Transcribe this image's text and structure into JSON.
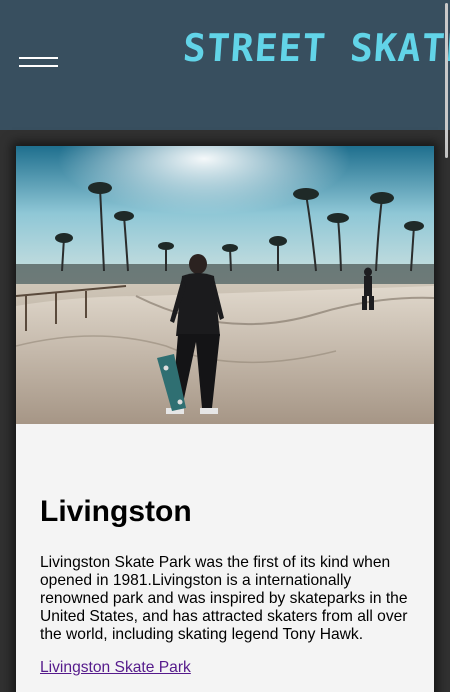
{
  "header": {
    "brand": "STREET SKATER",
    "menu_icon": "hamburger-menu-icon"
  },
  "card": {
    "image_alt": "Skater carrying a skateboard at an outdoor skate park with palm trees",
    "title": "Livingston",
    "description": "Livingston Skate Park was the first of its kind when opened in 1981.Livingston is a internationally renowned park and was inspired by skateparks in the United States, and has attracted skaters from all over the world, including skating legend Tony Hawk.",
    "link_text": "Livingston Skate Park"
  },
  "colors": {
    "page_background": "#313131",
    "header_background": "#384f5f",
    "brand": "#62d4e8",
    "card_background": "#f4f4f4",
    "link": "#551a8b"
  }
}
